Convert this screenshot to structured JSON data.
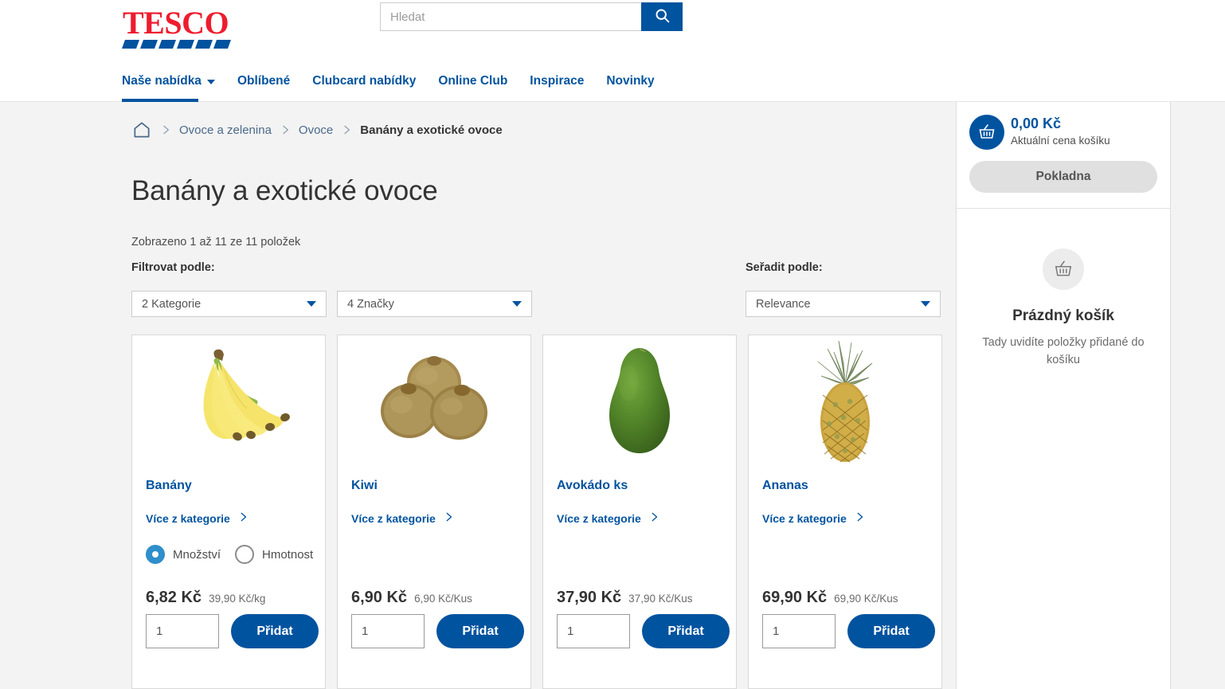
{
  "header": {
    "logo_text": "TESCO",
    "search": {
      "placeholder": "Hledat",
      "value": "",
      "icon": "search-icon"
    },
    "brand_color": "#00539f",
    "logo_color": "#ee1c2e"
  },
  "nav": {
    "items": [
      {
        "label": "Naše nabídka",
        "has_caret": true,
        "active": true
      },
      {
        "label": "Oblíbené",
        "has_caret": false,
        "active": false
      },
      {
        "label": "Clubcard nabídky",
        "has_caret": false,
        "active": false
      },
      {
        "label": "Online Club",
        "has_caret": false,
        "active": false
      },
      {
        "label": "Inspirace",
        "has_caret": false,
        "active": false
      },
      {
        "label": "Novinky",
        "has_caret": false,
        "active": false
      }
    ]
  },
  "breadcrumb": {
    "home_icon": "home-icon",
    "items": [
      {
        "label": "Ovoce a zelenina",
        "current": false
      },
      {
        "label": "Ovoce",
        "current": false
      },
      {
        "label": "Banány a exotické ovoce",
        "current": true
      }
    ]
  },
  "main": {
    "title": "Banány a exotické ovoce",
    "result_count": "Zobrazeno 1 až 11 ze 11 položek",
    "filter_label": "Filtrovat podle:",
    "sort_label": "Seřadit podle:",
    "filters": [
      {
        "name": "categories",
        "value": "2 Kategorie"
      },
      {
        "name": "brands",
        "value": "4 Značky"
      }
    ],
    "sort": {
      "value": "Relevance"
    }
  },
  "products": [
    {
      "name": "Banány",
      "image": "bananas-image",
      "more_label": "Více z kategorie",
      "has_unit_toggle": true,
      "unit_options": [
        {
          "label": "Množství",
          "selected": true
        },
        {
          "label": "Hmotnost",
          "selected": false
        }
      ],
      "price": "6,82 Kč",
      "unit_price": "39,90 Kč/kg",
      "quantity": "1",
      "add_label": "Přidat"
    },
    {
      "name": "Kiwi",
      "image": "kiwi-image",
      "more_label": "Více z kategorie",
      "has_unit_toggle": false,
      "unit_options": [],
      "price": "6,90 Kč",
      "unit_price": "6,90 Kč/Kus",
      "quantity": "1",
      "add_label": "Přidat"
    },
    {
      "name": "Avokádo ks",
      "image": "avocado-image",
      "more_label": "Více z kategorie",
      "has_unit_toggle": false,
      "unit_options": [],
      "price": "37,90 Kč",
      "unit_price": "37,90 Kč/Kus",
      "quantity": "1",
      "add_label": "Přidat"
    },
    {
      "name": "Ananas",
      "image": "pineapple-image",
      "more_label": "Více z kategorie",
      "has_unit_toggle": false,
      "unit_options": [],
      "price": "69,90 Kč",
      "unit_price": "69,90 Kč/Kus",
      "quantity": "1",
      "add_label": "Přidat"
    }
  ],
  "basket": {
    "icon": "basket-icon",
    "price": "0,00 Kč",
    "caption": "Aktuální cena košíku",
    "checkout_label": "Pokladna",
    "empty_icon": "basket-outline-icon",
    "empty_title": "Prázdný košík",
    "empty_subtitle": "Tady uvidíte položky přidané do košíku"
  }
}
